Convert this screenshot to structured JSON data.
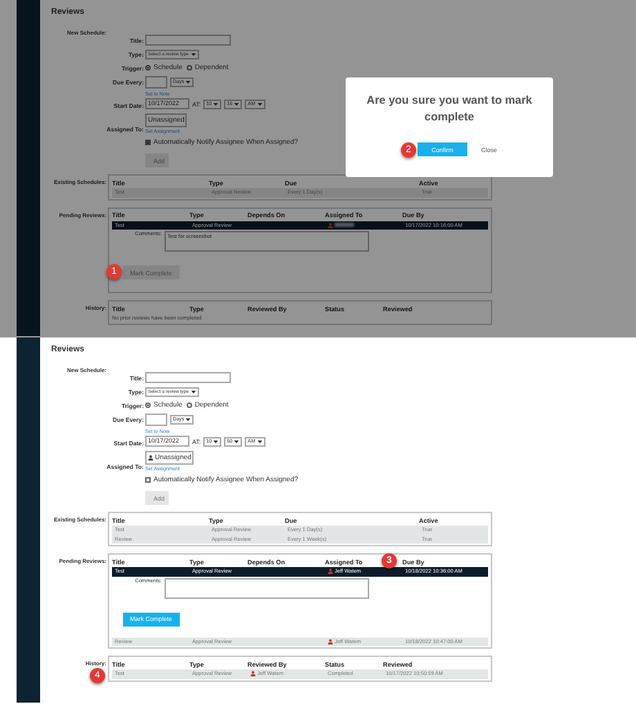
{
  "panels": [
    {
      "dimmed": true,
      "heading": "Reviews",
      "new_schedule": {
        "label": "New Schedule:",
        "title": {
          "label": "Title:"
        },
        "type": {
          "label": "Type:",
          "value": "Select a review type"
        },
        "trigger": {
          "label": "Trigger:",
          "options": [
            {
              "label": "Schedule",
              "selected": true
            },
            {
              "label": "Dependent",
              "selected": false
            }
          ]
        },
        "due_every": {
          "label": "Due Every:",
          "unit": "Days"
        },
        "start_date": {
          "label": "Start Date:",
          "link": "Set to Now",
          "date": "10/17/2022",
          "at_label": "AT:",
          "hour": "10",
          "minute": "16",
          "period": "AM"
        },
        "assigned_to": {
          "label": "Assigned To:",
          "value": "Unassigned",
          "person_icon": false,
          "link": "Set Assignment"
        },
        "notify": {
          "label": "Automatically Notify Assignee When Assigned?",
          "checked": true
        },
        "add_button": {
          "label": "Add",
          "disabled": true
        }
      },
      "existing_schedules": {
        "label": "Existing Schedules:",
        "columns": [
          "Title",
          "Type",
          "Due",
          "Active"
        ],
        "rows": [
          {
            "cells": [
              "Test",
              "Approval Review",
              "Every 1 Day(s)",
              "True"
            ]
          }
        ]
      },
      "pending_reviews": {
        "label": "Pending Reviews:",
        "columns": [
          "Title",
          "Type",
          "Depends On",
          "Assigned To",
          "Due By"
        ],
        "rows": [
          {
            "title": "Test",
            "type": "Approval Review",
            "assigned_to_redacted": true,
            "due_by": "10/17/2022 10:16:00 AM",
            "selected": true,
            "comments": {
              "label": "Comments:",
              "value": "Test for screenshot"
            },
            "mark_complete": {
              "label": "Mark Complete",
              "disabled": true,
              "callout": "1"
            }
          }
        ]
      },
      "history": {
        "label": "History:",
        "columns": [
          "Title",
          "Type",
          "Reviewed By",
          "Status",
          "Reviewed"
        ],
        "empty_message": "No prior reviews have been completed"
      },
      "modal": {
        "message": "Are you sure you want to mark complete",
        "confirm": {
          "label": "Confirm",
          "callout": "2"
        },
        "close": "Close"
      }
    },
    {
      "dimmed": false,
      "heading": "Reviews",
      "new_schedule": {
        "label": "New Schedule:",
        "title": {
          "label": "Title:"
        },
        "type": {
          "label": "Type:",
          "value": "Select a review type"
        },
        "trigger": {
          "label": "Trigger:",
          "options": [
            {
              "label": "Schedule",
              "selected": true
            },
            {
              "label": "Dependent",
              "selected": false
            }
          ]
        },
        "due_every": {
          "label": "Due Every:",
          "unit": "Days"
        },
        "start_date": {
          "label": "Start Date:",
          "link": "Set to Now",
          "date": "10/17/2022",
          "at_label": "AT:",
          "hour": "10",
          "minute": "50",
          "period": "AM"
        },
        "assigned_to": {
          "label": "Assigned To:",
          "value": "Unassigned",
          "person_icon": true,
          "link": "Set Assignment"
        },
        "notify": {
          "label": "Automatically Notify Assignee When Assigned?",
          "checked": false
        },
        "add_button": {
          "label": "Add",
          "disabled": true
        }
      },
      "existing_schedules": {
        "label": "Existing Schedules:",
        "columns": [
          "Title",
          "Type",
          "Due",
          "Active"
        ],
        "rows": [
          {
            "cells": [
              "Test",
              "Approval Review",
              "Every 1 Day(s)",
              "True"
            ]
          },
          {
            "cells": [
              "Review",
              "Approval Review",
              "Every 1 Week(s)",
              "True"
            ]
          }
        ]
      },
      "pending_reviews": {
        "label": "Pending Reviews:",
        "callout": "3",
        "columns": [
          "Title",
          "Type",
          "Depends On",
          "Assigned To",
          "Due By"
        ],
        "rows": [
          {
            "title": "Test",
            "type": "Approval Review",
            "assigned_to": "Jeff Watem",
            "due_by": "10/18/2022 10:36:00 AM",
            "selected": true,
            "comments": {
              "label": "Comments:"
            },
            "mark_complete": {
              "label": "Mark Complete",
              "disabled": false
            }
          },
          {
            "title": "Review",
            "type": "Approval Review",
            "assigned_to": "Jeff Watem",
            "due_by": "10/18/2022 10:47:00 AM",
            "selected": false
          }
        ]
      },
      "history": {
        "label": "History:",
        "callout": "4",
        "columns": [
          "Title",
          "Type",
          "Reviewed By",
          "Status",
          "Reviewed"
        ],
        "rows": [
          {
            "title": "Test",
            "type": "Approval Review",
            "reviewed_by": "Jeff Watem",
            "status": "Completed",
            "reviewed": "10/17/2022 10:50:59 AM"
          }
        ]
      }
    }
  ]
}
